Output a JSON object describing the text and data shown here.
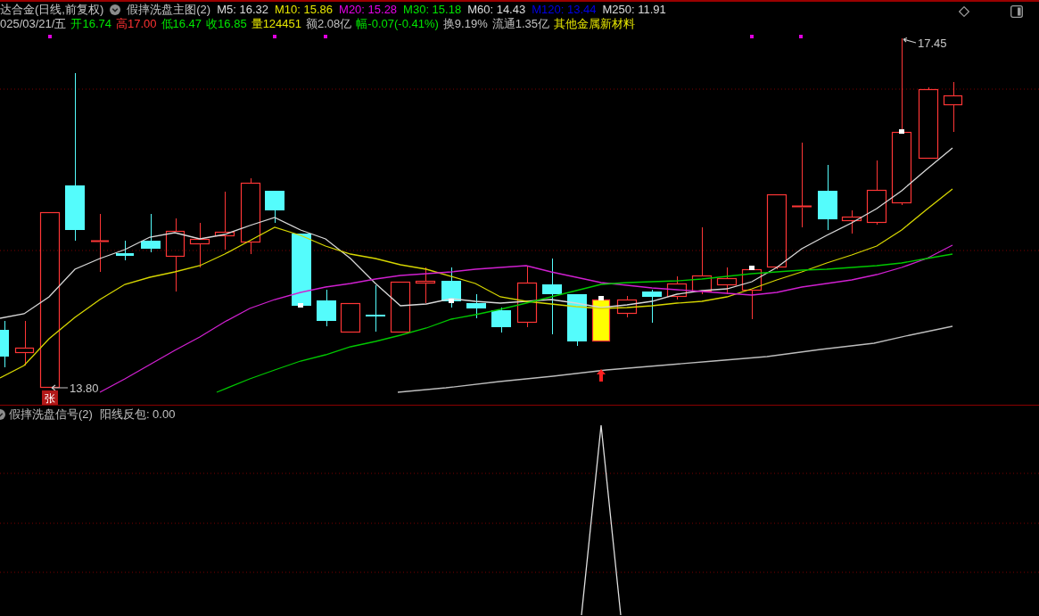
{
  "header": {
    "stock_title": "达合金(日线,前复权)",
    "indicator": "假摔洗盘主图(2)",
    "moving_averages": [
      {
        "label": "M5: 16.32",
        "color": "#dcdcdc"
      },
      {
        "label": "M10: 15.86",
        "color": "#e6e600"
      },
      {
        "label": "M20: 15.28",
        "color": "#e600e6"
      },
      {
        "label": "M30: 15.18",
        "color": "#00e600"
      },
      {
        "label": "M60: 14.43",
        "color": "#dcdcdc"
      },
      {
        "label": "M120: 13.44",
        "color": "#0000e6"
      },
      {
        "label": "M250: 11.91",
        "color": "#dcdcdc"
      }
    ]
  },
  "quote_bar": {
    "date": "025/03/21/五",
    "fields": [
      {
        "label": "开16.74",
        "color": "#00e600"
      },
      {
        "label": "高17.00",
        "color": "#ff3232"
      },
      {
        "label": "低16.47",
        "color": "#00e600"
      },
      {
        "label": "收16.85",
        "color": "#00e600"
      },
      {
        "label": "量124451",
        "color": "#e6e600"
      },
      {
        "label": "额2.08亿",
        "color": "#c0c0c0"
      },
      {
        "label": "幅-0.07(-0.41%)",
        "color": "#00e600"
      },
      {
        "label": "换9.19%",
        "color": "#c0c0c0"
      },
      {
        "label": "流通1.35亿",
        "color": "#c0c0c0"
      },
      {
        "label": "其他金属新材料",
        "color": "#e6e600"
      }
    ]
  },
  "main_chart": {
    "high_label": "17.45",
    "low_label": "13.80",
    "badge": "张"
  },
  "signal_panel": {
    "title": "假摔洗盘信号(2)",
    "reading": "阳线反包: 0.00"
  }
}
